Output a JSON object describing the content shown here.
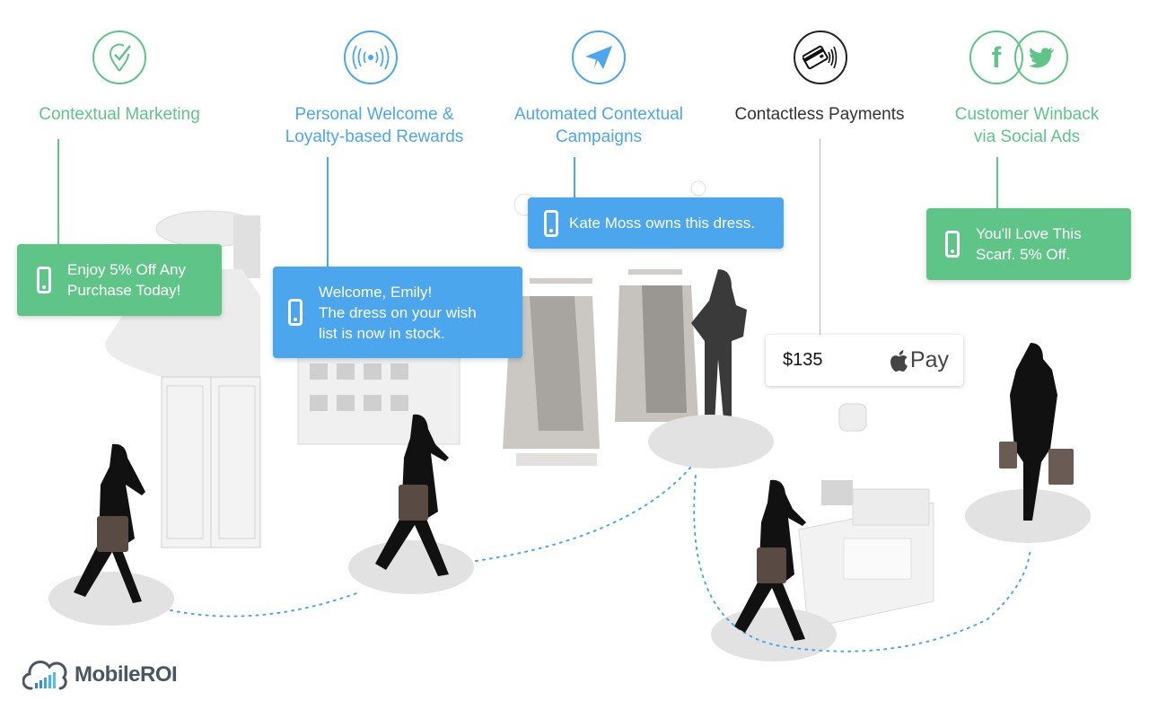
{
  "features": [
    {
      "label_lines": [
        "Contextual Marketing"
      ],
      "icon": "location-check-icon",
      "color": "#5ec488"
    },
    {
      "label_lines": [
        "Personal Welcome &",
        "Loyalty-based Rewards"
      ],
      "icon": "beacon-signal-icon",
      "color": "#4ba6ee"
    },
    {
      "label_lines": [
        "Automated Contextual",
        "Campaigns"
      ],
      "icon": "paper-plane-icon",
      "color": "#4ba6ee"
    },
    {
      "label_lines": [
        "Contactless Payments"
      ],
      "icon": "contactless-card-icon",
      "color": "#333333"
    },
    {
      "label_lines": [
        "Customer Winback",
        "via Social Ads"
      ],
      "icon": "facebook-twitter-icon",
      "color": "#5ec488"
    }
  ],
  "notifications": [
    {
      "lines": [
        "Enjoy 5% Off Any",
        "Purchase Today!"
      ],
      "icon": "phone-icon",
      "color": "#5ec488"
    },
    {
      "lines": [
        "Welcome, Emily!",
        "The dress on your wish",
        "list is now in stock."
      ],
      "icon": "phone-icon",
      "color": "#4ba6ee"
    },
    {
      "lines": [
        "Kate Moss owns this dress."
      ],
      "icon": "phone-icon",
      "color": "#4ba6ee"
    },
    {
      "lines": [
        "You'll Love This",
        "Scarf. 5% Off."
      ],
      "icon": "phone-icon",
      "color": "#5ec488"
    }
  ],
  "payment": {
    "amount": "$135",
    "brand": "Pay",
    "brand_icon": "apple-icon"
  },
  "logo": {
    "text": "MobileROI",
    "icon": "cloud-signal-icon"
  },
  "social": {
    "facebook": "f"
  }
}
